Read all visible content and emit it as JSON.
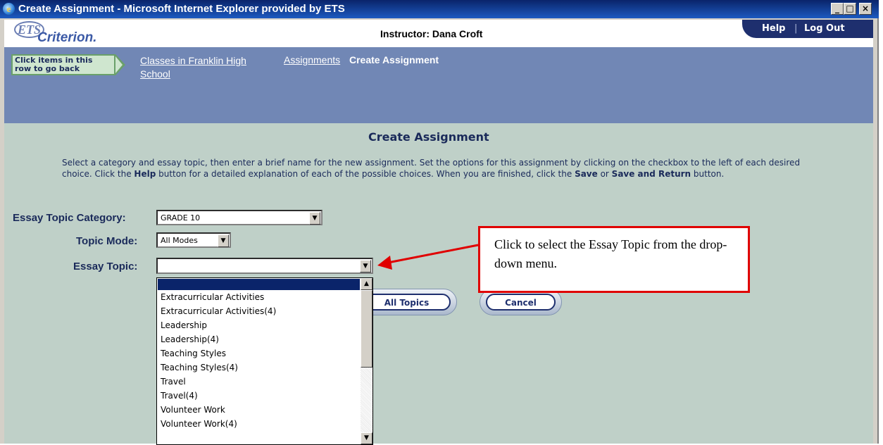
{
  "window": {
    "title": "Create Assignment - Microsoft Internet Explorer provided by ETS",
    "icon": "ie-icon",
    "controls": [
      "_",
      "□",
      "×"
    ]
  },
  "header": {
    "logo_ets": "ETS",
    "logo_criterion": "Criterion.",
    "instructor": "Instructor: Dana Croft",
    "help": "Help",
    "separator": "|",
    "logout": "Log Out"
  },
  "breadcrumb": {
    "hint": "Click items in this row to go back",
    "classes": "Classes in Franklin High School",
    "assignments": "Assignments",
    "current": "Create Assignment"
  },
  "page": {
    "title": "Create Assignment",
    "instructions_1": "Select a category and essay topic, then enter a brief name for the new assignment. Set the options for this assignment by clicking on the checkbox to the left of each desired choice. Click the ",
    "instructions_help": "Help",
    "instructions_2": " button for a detailed explanation of each of the possible choices. When you are finished, click the ",
    "instructions_save": "Save",
    "instructions_3": " or ",
    "instructions_save_return": "Save and Return",
    "instructions_4": " button."
  },
  "form": {
    "category_label": "Essay Topic Category:",
    "category_value": "GRADE 10",
    "mode_label": "Topic Mode:",
    "mode_value": "All Modes",
    "topic_label": "Essay Topic:",
    "topic_value": "",
    "topic_options": [
      "",
      "Extracurricular Activities",
      "Extracurricular Activities(4)",
      "Leadership",
      "Leadership(4)",
      "Teaching Styles",
      "Teaching Styles(4)",
      "Travel",
      "Travel(4)",
      "Volunteer Work",
      "Volunteer Work(4)"
    ]
  },
  "buttons": {
    "all_topics": "All Topics",
    "cancel": "Cancel"
  },
  "callout": {
    "text": "Click to select the Essay Topic from the drop-down menu."
  },
  "colors": {
    "titlebar": "#0a246a",
    "crumbbar": "#7187b5",
    "content_bg": "#bfd0c8",
    "callout_border": "#e00000",
    "arrow": "#e00000"
  }
}
